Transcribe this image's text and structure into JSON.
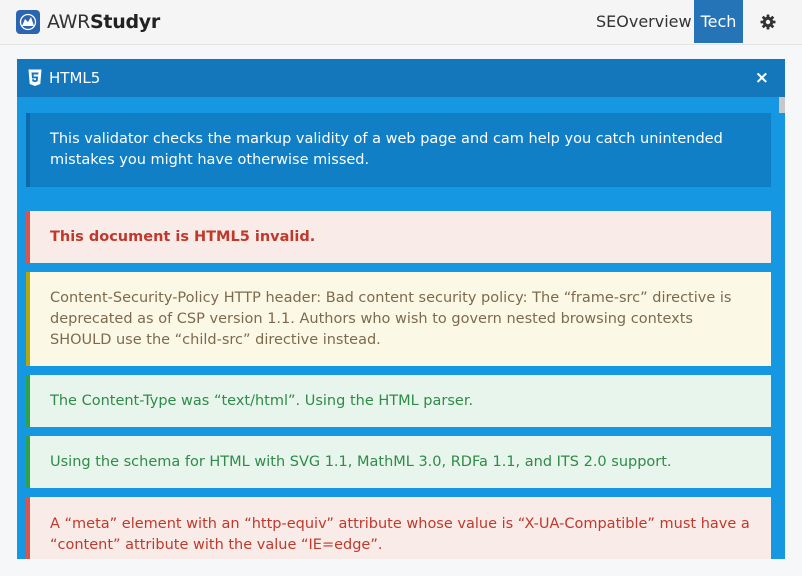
{
  "app": {
    "brand_light": "AWR",
    "brand_bold": "Studyr"
  },
  "nav": {
    "items": [
      {
        "label": "SEOverview",
        "active": false
      },
      {
        "label": "Tech",
        "active": true
      }
    ],
    "settings_icon": "gear-icon"
  },
  "panel": {
    "title": "HTML5",
    "icon": "html5-icon",
    "close_label": "×",
    "intro": "This validator checks the markup validity of a web page and cam help you catch unintended mistakes you might have otherwise missed.",
    "messages": [
      {
        "type": "error",
        "text": "This document is HTML5 invalid."
      },
      {
        "type": "warning",
        "text": "Content-Security-Policy HTTP header: Bad content security policy: The “frame-src” directive is deprecated as of CSP version 1.1. Authors who wish to govern nested browsing contexts SHOULD use the “child-src” directive instead."
      },
      {
        "type": "info",
        "text": "The Content-Type was “text/html”. Using the HTML parser."
      },
      {
        "type": "info",
        "text": "Using the schema for HTML with SVG 1.1, MathML 3.0, RDFa 1.1, and ITS 2.0 support."
      },
      {
        "type": "error",
        "text": "A “meta” element with an “http-equiv” attribute whose value is “X-UA-Compatible” must have a “content” attribute with the value “IE=edge”."
      }
    ]
  },
  "colors": {
    "nav_active": "#2574b8",
    "panel_header": "#1477bb",
    "panel_body": "#1597e1",
    "error": "#c0392b",
    "warning": "#7d6a4e",
    "info": "#2e8b48"
  }
}
